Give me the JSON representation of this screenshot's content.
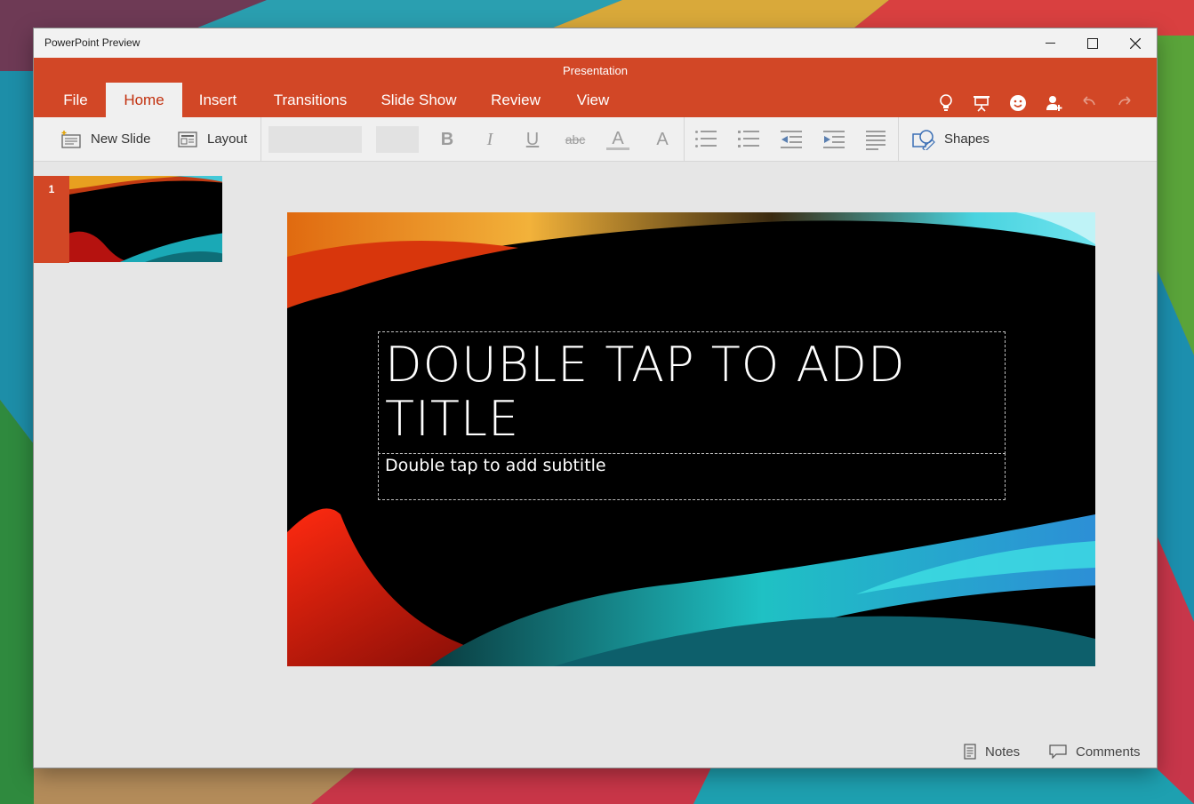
{
  "window": {
    "app_title": "PowerPoint Preview",
    "doc_title": "Presentation"
  },
  "tabs": [
    {
      "label": "File"
    },
    {
      "label": "Home",
      "active": true
    },
    {
      "label": "Insert"
    },
    {
      "label": "Transitions"
    },
    {
      "label": "Slide Show"
    },
    {
      "label": "Review"
    },
    {
      "label": "View"
    }
  ],
  "ribbon_icons": [
    "lightbulb-icon",
    "present-icon",
    "smiley-icon",
    "share-person-icon",
    "undo-icon",
    "redo-icon"
  ],
  "toolbar": {
    "new_slide_label": "New Slide",
    "layout_label": "Layout",
    "bold_glyph": "B",
    "italic_glyph": "I",
    "underline_glyph": "U",
    "strike_glyph": "abc",
    "font_color_glyph": "A",
    "highlight_glyph": "A",
    "shapes_label": "Shapes"
  },
  "thumbnails": [
    {
      "number": "1"
    }
  ],
  "slide": {
    "title_placeholder": "DOUBLE TAP TO ADD TITLE",
    "subtitle_placeholder": "Double tap to add subtitle"
  },
  "status": {
    "notes_label": "Notes",
    "comments_label": "Comments"
  },
  "colors": {
    "accent": "#d24726",
    "toolbar_bg": "#f0f0f0",
    "canvas_bg": "#e6e6e6"
  }
}
